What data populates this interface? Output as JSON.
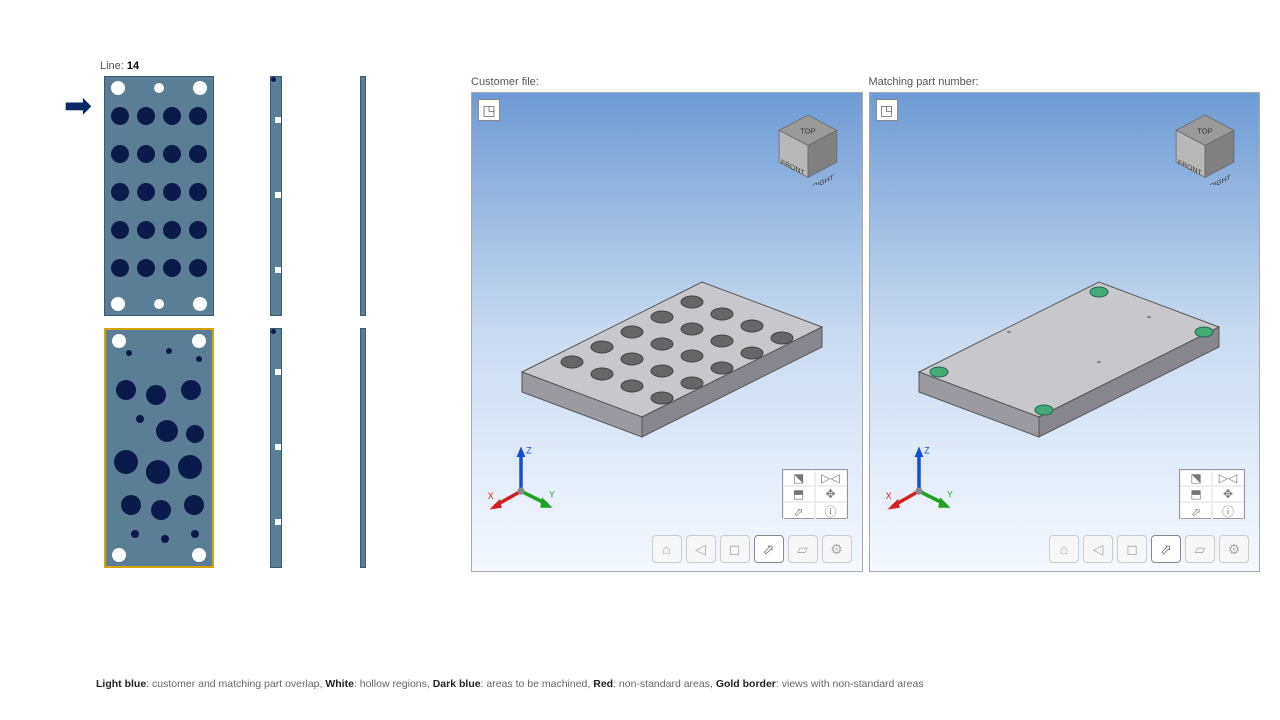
{
  "line": {
    "label": "Line:",
    "value": "14"
  },
  "viewers": {
    "left_label": "Customer file:",
    "right_label": "Matching part number:",
    "cube": {
      "top": "TOP",
      "front": "FRONT",
      "right": "RIGHT"
    },
    "axes": {
      "x": "X",
      "y": "Y",
      "z": "Z"
    }
  },
  "legend": {
    "lightblue_k": "Light blue",
    "lightblue_v": ": customer and matching part overlap, ",
    "white_k": "White",
    "white_v": ": hollow regions, ",
    "darkblue_k": "Dark blue",
    "darkblue_v": ": areas to be machined, ",
    "red_k": "Red",
    "red_v": ": non-standard areas, ",
    "gold_k": "Gold border",
    "gold_v": ": views with non-standard areas"
  }
}
